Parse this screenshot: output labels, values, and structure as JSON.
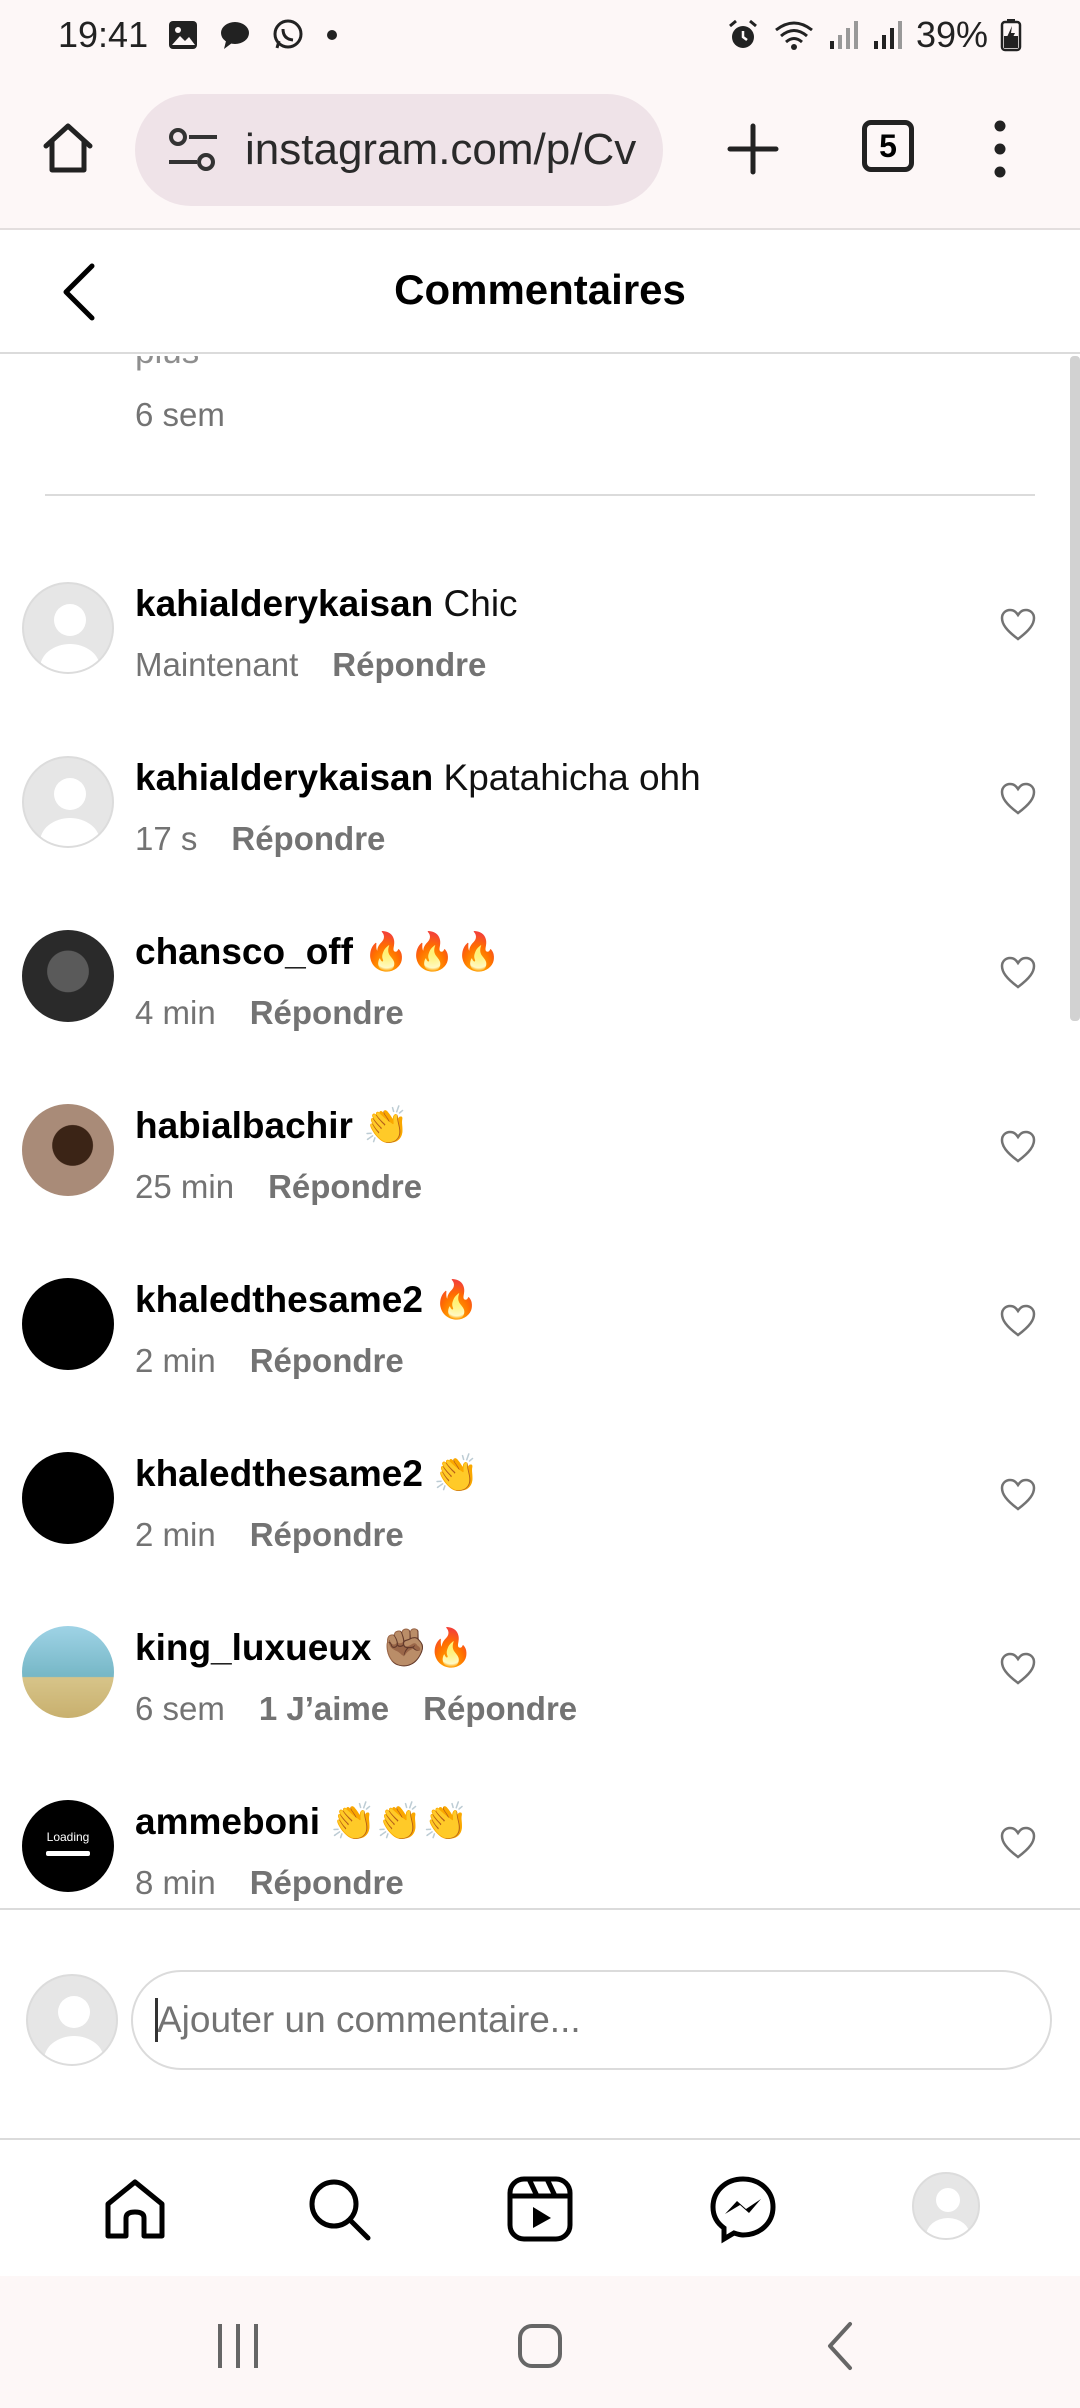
{
  "status_bar": {
    "time": "19:41",
    "battery": "39%",
    "icons": [
      "gallery-icon",
      "chat-bubble-icon",
      "whatsapp-icon",
      "dot-icon",
      "alarm-icon",
      "wifi-icon",
      "signal-icon",
      "signal-icon",
      "battery-charging-icon"
    ]
  },
  "browser": {
    "url": "instagram.com/p/Cv",
    "tab_count": "5",
    "icons": [
      "home-icon",
      "site-settings-icon",
      "plus-icon",
      "tabs-icon",
      "more-vert-icon"
    ]
  },
  "header": {
    "title": "Commentaires"
  },
  "previous_comment": {
    "more_text": "plus",
    "time": "6 sem"
  },
  "comments": [
    {
      "user": "kahialderykaisan",
      "text": "Chic",
      "time": "Maintenant",
      "likes": "",
      "reply": "Répondre",
      "avatar": "default"
    },
    {
      "user": "kahialderykaisan",
      "text": "Kpatahicha ohh",
      "time": "17 s",
      "likes": "",
      "reply": "Répondre",
      "avatar": "default"
    },
    {
      "user": "chansco_off",
      "text": "🔥🔥🔥",
      "time": "4 min",
      "likes": "",
      "reply": "Répondre",
      "avatar": "photo1"
    },
    {
      "user": "habialbachir",
      "text": "👏",
      "time": "25 min",
      "likes": "",
      "reply": "Répondre",
      "avatar": "photo2"
    },
    {
      "user": "khaledthesame2",
      "text": "🔥",
      "time": "2 min",
      "likes": "",
      "reply": "Répondre",
      "avatar": "black"
    },
    {
      "user": "khaledthesame2",
      "text": "👏",
      "time": "2 min",
      "likes": "",
      "reply": "Répondre",
      "avatar": "black"
    },
    {
      "user": "king_luxueux",
      "text": "✊🏽🔥",
      "time": "6 sem",
      "likes": "1 J’aime",
      "reply": "Répondre",
      "avatar": "photo3"
    },
    {
      "user": "ammeboni",
      "text": "👏👏👏",
      "time": "8 min",
      "likes": "",
      "reply": "Répondre",
      "avatar": "loading"
    }
  ],
  "avatar_loading_text": "Loading",
  "input": {
    "placeholder": "Ajouter un commentaire..."
  },
  "bottom_nav": {
    "items": [
      "home-icon",
      "search-icon",
      "reels-icon",
      "messenger-icon",
      "profile-avatar"
    ]
  },
  "system_nav": {
    "items": [
      "recents-icon",
      "home-circle-icon",
      "back-icon"
    ]
  },
  "colors": {
    "secondary_text": "#737373",
    "divider": "#dbdbdb",
    "browser_bg": "#fdf7f7",
    "url_pill_bg": "#efe3e8"
  }
}
